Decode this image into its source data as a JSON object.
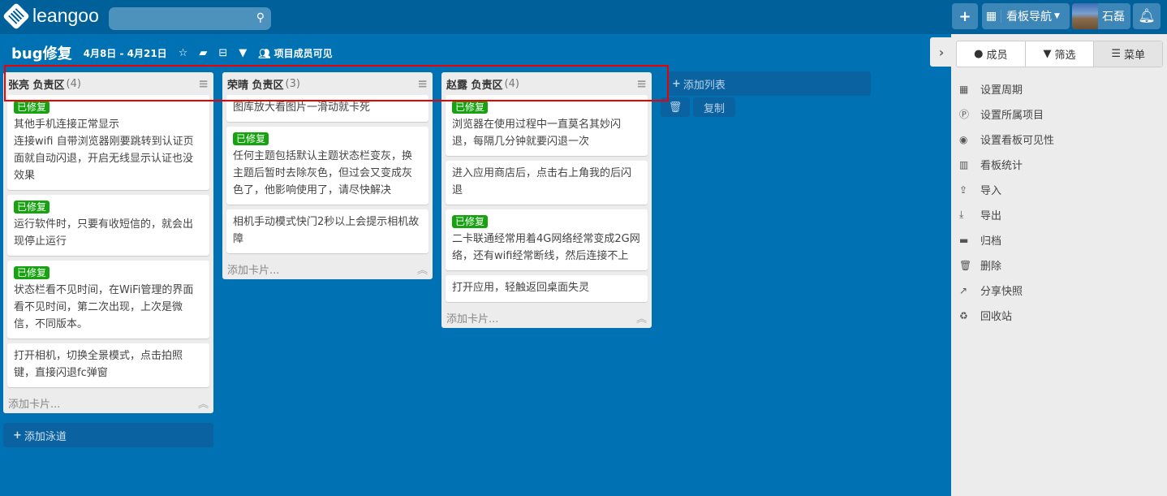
{
  "topbar": {
    "logo": "leangoo",
    "search_placeholder": "",
    "add": "+",
    "board_nav": "看板导航",
    "user": "石磊"
  },
  "board": {
    "title": "bug修复",
    "dates": "4月8日 - 4月21日",
    "visibility": "项目成员可见"
  },
  "lanes": [
    {
      "name": "张亮 负责区",
      "count": "(4)",
      "cards": [
        {
          "tag": "已修复",
          "text": "其他手机连接正常显示\n连接wifi 自带浏览器刚要跳转到认证页面就自动闪退，开启无线显示认证也没效果"
        },
        {
          "tag": "已修复",
          "text": "运行软件时，只要有收短信的，就会出现停止运行"
        },
        {
          "tag": "已修复",
          "text": "状态栏看不见时间，在WiFi管理的界面看不见时间，第二次出现，上次是微信，不同版本。"
        },
        {
          "tag": null,
          "text": "打开相机，切换全景模式，点击拍照键，直接闪退fc弹窗"
        }
      ]
    },
    {
      "name": "荣晴 负责区",
      "count": "(3)",
      "cards": [
        {
          "tag": null,
          "text": "图库放大看图片一滑动就卡死"
        },
        {
          "tag": "已修复",
          "text": "任何主题包括默认主题状态栏变灰，换主题后暂时去除灰色，但过会又变成灰色了，他影响使用了，请尽快解决"
        },
        {
          "tag": null,
          "text": "相机手动模式快门2秒以上会提示相机故障"
        }
      ]
    },
    {
      "name": "赵露 负责区",
      "count": "(4)",
      "cards": [
        {
          "tag": "已修复",
          "text": "浏览器在使用过程中一直莫名其妙闪退，每隔几分钟就要闪退一次"
        },
        {
          "tag": null,
          "text": "进入应用商店后，点击右上角我的后闪退"
        },
        {
          "tag": "已修复",
          "text": "二卡联通经常用着4G网络经常变成2G网络，还有wifi经常断线，然后连接不上"
        },
        {
          "tag": null,
          "text": "打开应用，轻触返回桌面失灵"
        }
      ]
    }
  ],
  "add_card": "添加卡片...",
  "add_list": "添加列表",
  "copy": "复制",
  "add_swimlane": "添加泳道",
  "panel": {
    "tabs": [
      "成员",
      "筛选",
      "菜单"
    ],
    "items": [
      "设置周期",
      "设置所属项目",
      "设置看板可见性",
      "看板统计",
      "导入",
      "导出",
      "归档",
      "删除",
      "分享快照",
      "回收站"
    ]
  }
}
